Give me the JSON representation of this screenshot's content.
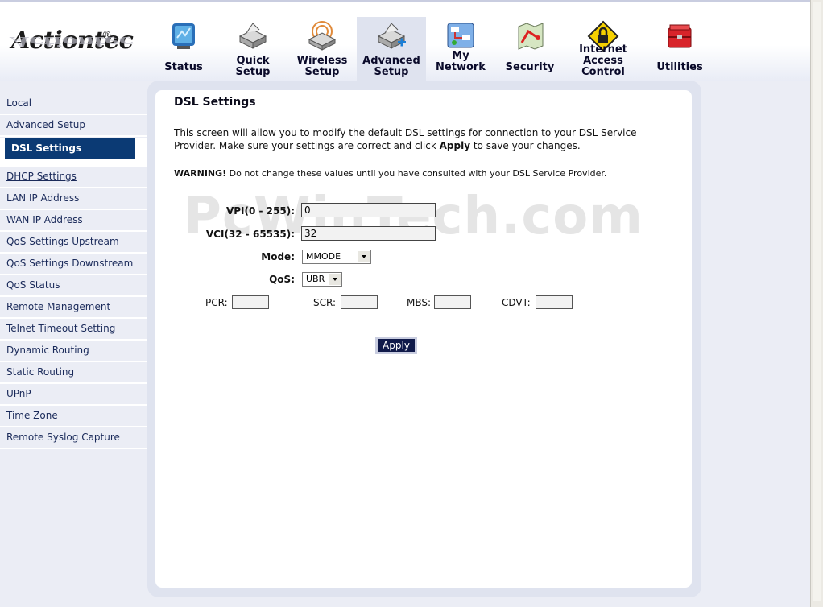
{
  "brand": {
    "logo_text": "Actiontec",
    "registered": "®"
  },
  "nav": [
    {
      "line1": "Status",
      "line2": ""
    },
    {
      "line1": "Quick",
      "line2": "Setup"
    },
    {
      "line1": "Wireless",
      "line2": "Setup"
    },
    {
      "line1": "Advanced",
      "line2": "Setup",
      "active": true
    },
    {
      "line1": "My Network",
      "line2": ""
    },
    {
      "line1": "Security",
      "line2": ""
    },
    {
      "line1": "Internet Access",
      "line2": "Control"
    },
    {
      "line1": "Utilities",
      "line2": ""
    }
  ],
  "sidebar": {
    "items": [
      "Local",
      "Advanced Setup",
      "DSL Settings",
      "DHCP Settings",
      "LAN IP Address",
      "WAN IP Address",
      "QoS Settings Upstream",
      "QoS Settings Downstream",
      "QoS Status",
      "Remote Management",
      "Telnet Timeout Setting",
      "Dynamic Routing",
      "Static Routing",
      "UPnP",
      "Time Zone",
      "Remote Syslog Capture"
    ]
  },
  "page": {
    "title": "DSL Settings",
    "desc_before": "This screen will allow you to modify the default DSL settings for connection to your DSL Service Provider. Make sure your settings are correct and click ",
    "desc_bold": "Apply",
    "desc_after": " to save your changes.",
    "warning_bold": "WARNING!",
    "warning_text": " Do not change these values until you have consulted with your DSL Service Provider.",
    "watermark": "PcWinTech.com"
  },
  "form": {
    "vpi_label": "VPI(0 - 255):",
    "vpi_value": "0",
    "vci_label": "VCI(32 - 65535):",
    "vci_value": "32",
    "mode_label": "Mode:",
    "mode_value": "MMODE",
    "qos_label": "QoS:",
    "qos_value": "UBR",
    "pcr_label": "PCR:",
    "scr_label": "SCR:",
    "mbs_label": "MBS:",
    "cdvt_label": "CDVT:",
    "apply_label": "Apply"
  },
  "colors": {
    "sidebar_active": "#0b3a74",
    "panel_frame": "#dfe3ef",
    "button": "#101a4a"
  }
}
